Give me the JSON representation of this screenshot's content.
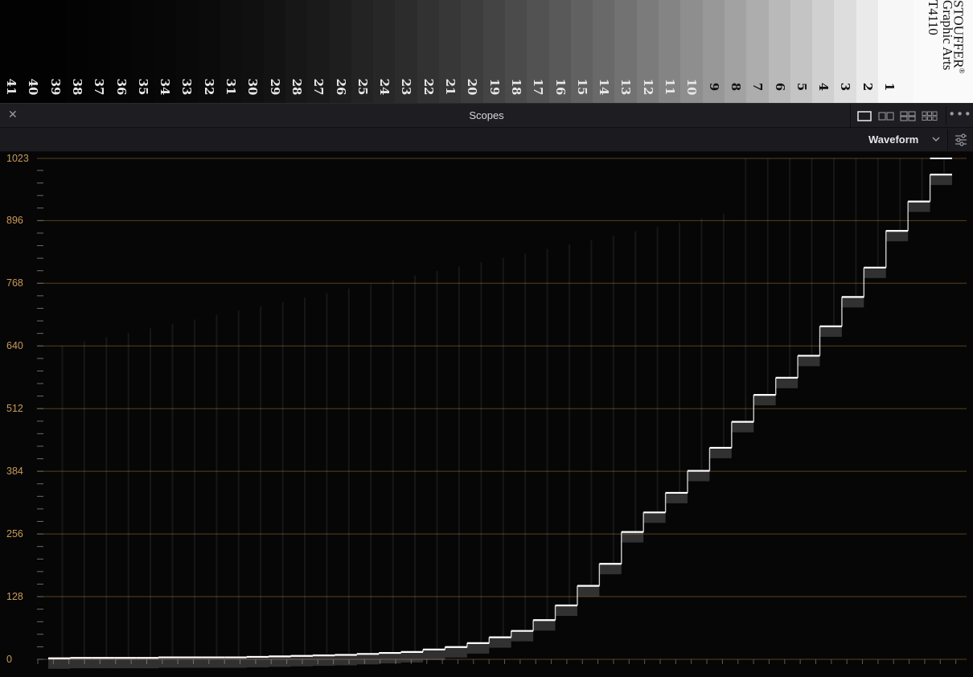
{
  "wedge": {
    "steps": [
      "41",
      "40",
      "39",
      "38",
      "37",
      "36",
      "35",
      "34",
      "33",
      "32",
      "31",
      "30",
      "29",
      "28",
      "27",
      "26",
      "25",
      "24",
      "23",
      "22",
      "21",
      "20",
      "19",
      "18",
      "17",
      "16",
      "15",
      "14",
      "13",
      "12",
      "11",
      "10",
      "9",
      "8",
      "7",
      "6",
      "5",
      "4",
      "3",
      "2",
      "1"
    ],
    "brand": {
      "line1": "STOUFFER",
      "trademark": "®",
      "line2": "Graphic Arts",
      "line3": "T4110"
    }
  },
  "panel": {
    "title": "Scopes",
    "close_icon": "close-icon",
    "layout_icons": [
      "single-view-icon",
      "dual-view-icon",
      "quad-view-icon",
      "multi-view-icon"
    ],
    "more_icon": "more-options-icon"
  },
  "toolbar": {
    "mode_label": "Waveform",
    "chevron_icon": "chevron-down-icon",
    "settings_icon": "scope-settings-icon"
  },
  "scope": {
    "type": "waveform",
    "y_labels": [
      "1023",
      "896",
      "768",
      "640",
      "512",
      "384",
      "256",
      "128",
      "0"
    ],
    "y_range": [
      0,
      1023
    ],
    "grid_color": "#5a3f22",
    "label_color": "#c89a5a",
    "trace_color": "#ffffff"
  },
  "chart_data": {
    "type": "waveform",
    "categories": [
      "41",
      "40",
      "39",
      "38",
      "37",
      "36",
      "35",
      "34",
      "33",
      "32",
      "31",
      "30",
      "29",
      "28",
      "27",
      "26",
      "25",
      "24",
      "23",
      "22",
      "21",
      "20",
      "19",
      "18",
      "17",
      "16",
      "15",
      "14",
      "13",
      "12",
      "11",
      "10",
      "9",
      "8",
      "7",
      "6",
      "5",
      "4",
      "3",
      "2",
      "1"
    ],
    "step_levels": [
      2,
      3,
      3,
      3,
      3,
      4,
      4,
      4,
      4,
      5,
      6,
      7,
      8,
      9,
      11,
      13,
      15,
      20,
      25,
      33,
      45,
      58,
      80,
      110,
      150,
      195,
      260,
      300,
      340,
      385,
      432,
      485,
      540,
      575,
      620,
      680,
      740,
      800,
      875,
      935,
      990
    ],
    "ylim": [
      0,
      1023
    ],
    "y_ticks": [
      0,
      128,
      256,
      384,
      512,
      640,
      768,
      896,
      1023
    ]
  }
}
